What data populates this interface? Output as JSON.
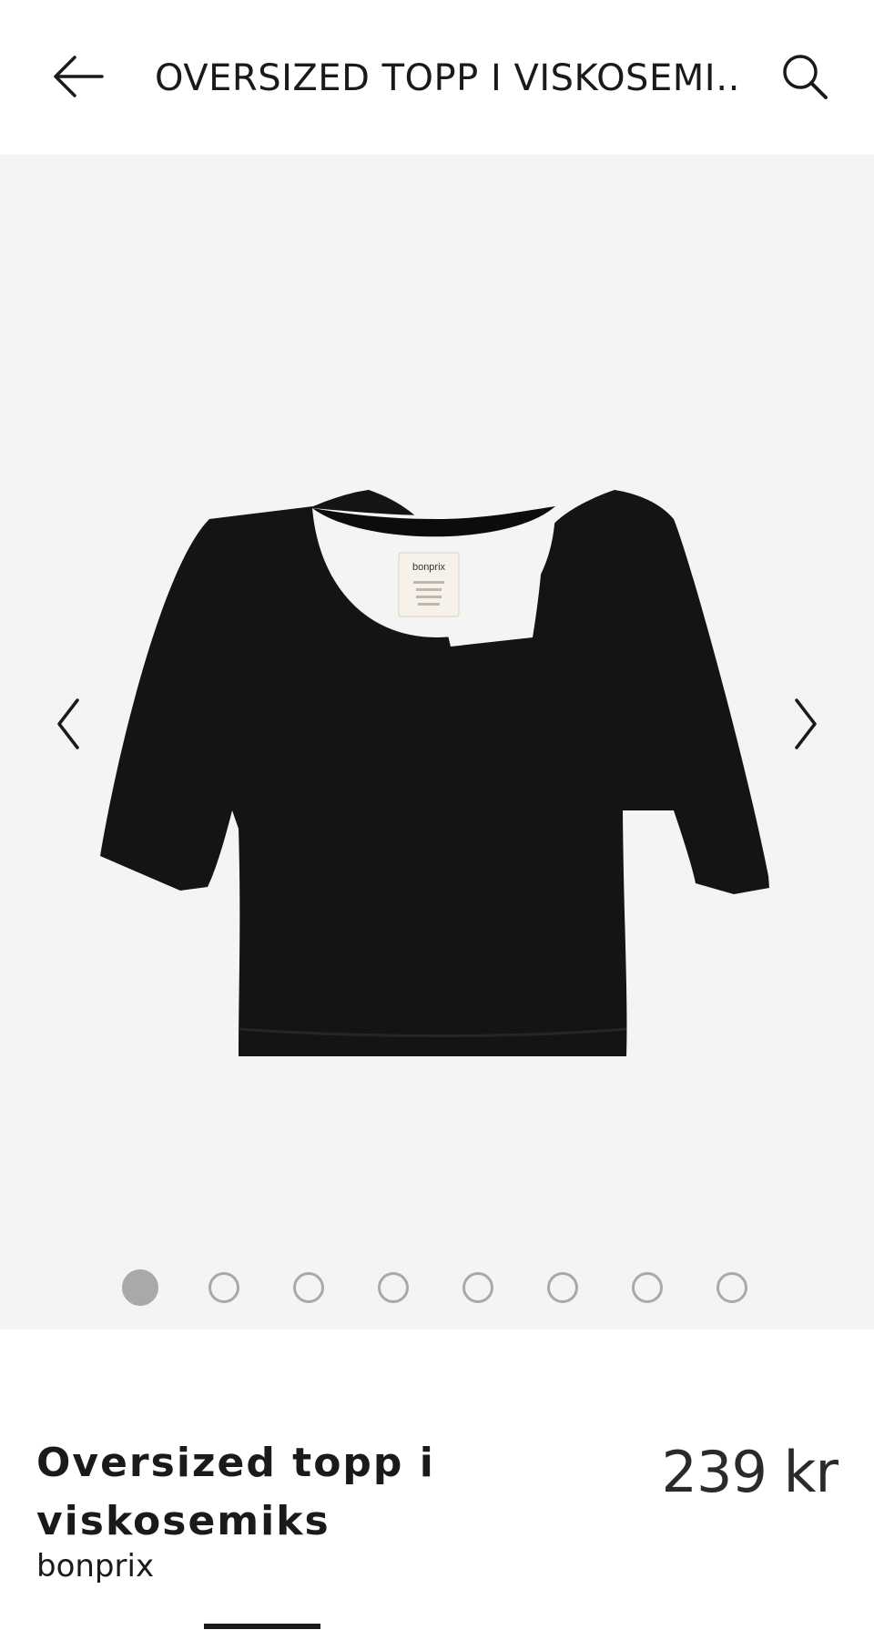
{
  "header": {
    "title": "OVERSIZED TOPP I VISKOSEMI…"
  },
  "icons": {
    "back": "arrow-left-icon",
    "search": "search-icon",
    "prev": "chevron-left-icon",
    "next": "chevron-right-icon"
  },
  "gallery": {
    "label_brand": "bonprix",
    "image_count": 8,
    "active_index": 0
  },
  "product": {
    "name": "Oversized topp i viskosemiks",
    "brand": "bonprix",
    "price": "239 kr"
  },
  "colors": {
    "gallery_bg": "#f4f4f4",
    "garment": "#141414",
    "dot": "#a9a9a9"
  }
}
